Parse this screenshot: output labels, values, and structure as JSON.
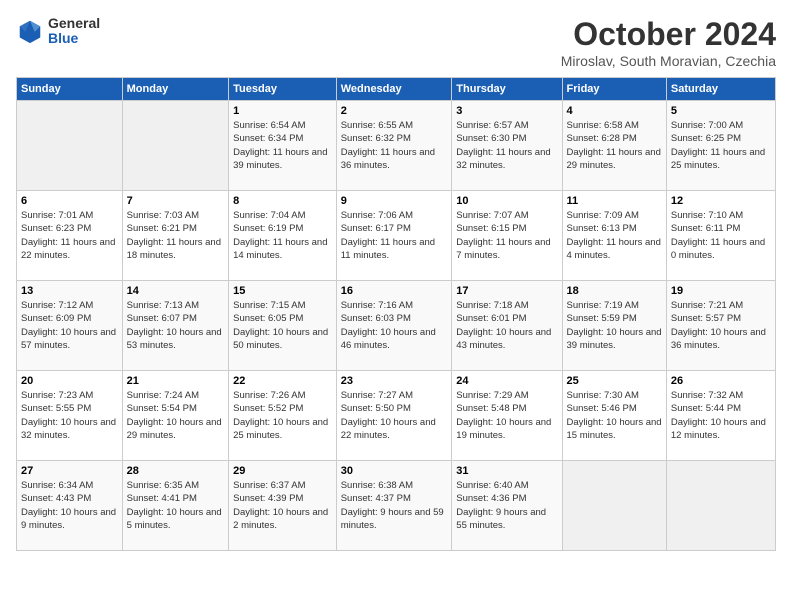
{
  "logo": {
    "general": "General",
    "blue": "Blue"
  },
  "title": "October 2024",
  "subtitle": "Miroslav, South Moravian, Czechia",
  "days_header": [
    "Sunday",
    "Monday",
    "Tuesday",
    "Wednesday",
    "Thursday",
    "Friday",
    "Saturday"
  ],
  "weeks": [
    [
      {
        "day": "",
        "info": ""
      },
      {
        "day": "",
        "info": ""
      },
      {
        "day": "1",
        "info": "Sunrise: 6:54 AM\nSunset: 6:34 PM\nDaylight: 11 hours and 39 minutes."
      },
      {
        "day": "2",
        "info": "Sunrise: 6:55 AM\nSunset: 6:32 PM\nDaylight: 11 hours and 36 minutes."
      },
      {
        "day": "3",
        "info": "Sunrise: 6:57 AM\nSunset: 6:30 PM\nDaylight: 11 hours and 32 minutes."
      },
      {
        "day": "4",
        "info": "Sunrise: 6:58 AM\nSunset: 6:28 PM\nDaylight: 11 hours and 29 minutes."
      },
      {
        "day": "5",
        "info": "Sunrise: 7:00 AM\nSunset: 6:25 PM\nDaylight: 11 hours and 25 minutes."
      }
    ],
    [
      {
        "day": "6",
        "info": "Sunrise: 7:01 AM\nSunset: 6:23 PM\nDaylight: 11 hours and 22 minutes."
      },
      {
        "day": "7",
        "info": "Sunrise: 7:03 AM\nSunset: 6:21 PM\nDaylight: 11 hours and 18 minutes."
      },
      {
        "day": "8",
        "info": "Sunrise: 7:04 AM\nSunset: 6:19 PM\nDaylight: 11 hours and 14 minutes."
      },
      {
        "day": "9",
        "info": "Sunrise: 7:06 AM\nSunset: 6:17 PM\nDaylight: 11 hours and 11 minutes."
      },
      {
        "day": "10",
        "info": "Sunrise: 7:07 AM\nSunset: 6:15 PM\nDaylight: 11 hours and 7 minutes."
      },
      {
        "day": "11",
        "info": "Sunrise: 7:09 AM\nSunset: 6:13 PM\nDaylight: 11 hours and 4 minutes."
      },
      {
        "day": "12",
        "info": "Sunrise: 7:10 AM\nSunset: 6:11 PM\nDaylight: 11 hours and 0 minutes."
      }
    ],
    [
      {
        "day": "13",
        "info": "Sunrise: 7:12 AM\nSunset: 6:09 PM\nDaylight: 10 hours and 57 minutes."
      },
      {
        "day": "14",
        "info": "Sunrise: 7:13 AM\nSunset: 6:07 PM\nDaylight: 10 hours and 53 minutes."
      },
      {
        "day": "15",
        "info": "Sunrise: 7:15 AM\nSunset: 6:05 PM\nDaylight: 10 hours and 50 minutes."
      },
      {
        "day": "16",
        "info": "Sunrise: 7:16 AM\nSunset: 6:03 PM\nDaylight: 10 hours and 46 minutes."
      },
      {
        "day": "17",
        "info": "Sunrise: 7:18 AM\nSunset: 6:01 PM\nDaylight: 10 hours and 43 minutes."
      },
      {
        "day": "18",
        "info": "Sunrise: 7:19 AM\nSunset: 5:59 PM\nDaylight: 10 hours and 39 minutes."
      },
      {
        "day": "19",
        "info": "Sunrise: 7:21 AM\nSunset: 5:57 PM\nDaylight: 10 hours and 36 minutes."
      }
    ],
    [
      {
        "day": "20",
        "info": "Sunrise: 7:23 AM\nSunset: 5:55 PM\nDaylight: 10 hours and 32 minutes."
      },
      {
        "day": "21",
        "info": "Sunrise: 7:24 AM\nSunset: 5:54 PM\nDaylight: 10 hours and 29 minutes."
      },
      {
        "day": "22",
        "info": "Sunrise: 7:26 AM\nSunset: 5:52 PM\nDaylight: 10 hours and 25 minutes."
      },
      {
        "day": "23",
        "info": "Sunrise: 7:27 AM\nSunset: 5:50 PM\nDaylight: 10 hours and 22 minutes."
      },
      {
        "day": "24",
        "info": "Sunrise: 7:29 AM\nSunset: 5:48 PM\nDaylight: 10 hours and 19 minutes."
      },
      {
        "day": "25",
        "info": "Sunrise: 7:30 AM\nSunset: 5:46 PM\nDaylight: 10 hours and 15 minutes."
      },
      {
        "day": "26",
        "info": "Sunrise: 7:32 AM\nSunset: 5:44 PM\nDaylight: 10 hours and 12 minutes."
      }
    ],
    [
      {
        "day": "27",
        "info": "Sunrise: 6:34 AM\nSunset: 4:43 PM\nDaylight: 10 hours and 9 minutes."
      },
      {
        "day": "28",
        "info": "Sunrise: 6:35 AM\nSunset: 4:41 PM\nDaylight: 10 hours and 5 minutes."
      },
      {
        "day": "29",
        "info": "Sunrise: 6:37 AM\nSunset: 4:39 PM\nDaylight: 10 hours and 2 minutes."
      },
      {
        "day": "30",
        "info": "Sunrise: 6:38 AM\nSunset: 4:37 PM\nDaylight: 9 hours and 59 minutes."
      },
      {
        "day": "31",
        "info": "Sunrise: 6:40 AM\nSunset: 4:36 PM\nDaylight: 9 hours and 55 minutes."
      },
      {
        "day": "",
        "info": ""
      },
      {
        "day": "",
        "info": ""
      }
    ]
  ]
}
